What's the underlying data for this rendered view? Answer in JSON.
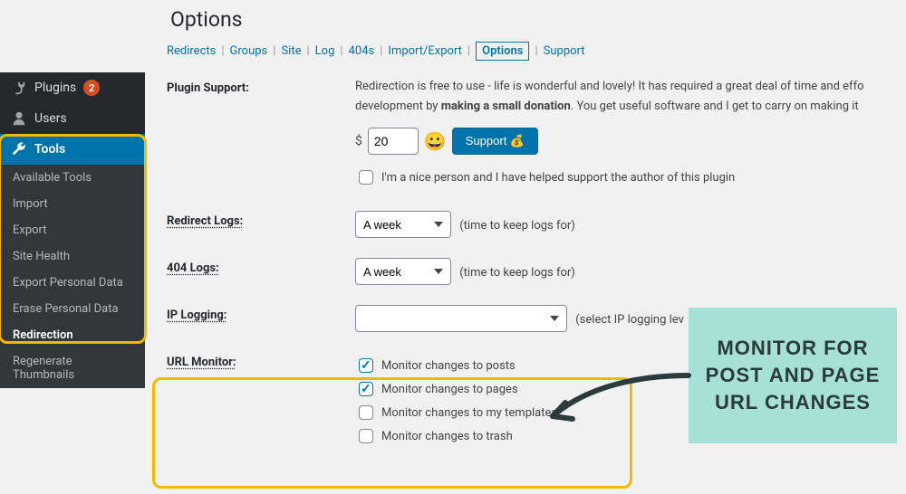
{
  "page": {
    "title": "Options"
  },
  "tabs": {
    "items": [
      "Redirects",
      "Groups",
      "Site",
      "Log",
      "404s",
      "Import/Export",
      "Options",
      "Support"
    ],
    "active": "Options"
  },
  "sidebar": {
    "plugins": {
      "label": "Plugins",
      "badge": "2"
    },
    "users": {
      "label": "Users"
    },
    "tools": {
      "label": "Tools"
    },
    "subs": [
      "Available Tools",
      "Import",
      "Export",
      "Site Health",
      "Export Personal Data",
      "Erase Personal Data",
      "Redirection",
      "Regenerate Thumbnails"
    ]
  },
  "support": {
    "label": "Plugin Support:",
    "desc1_a": "Redirection is free to use - life is wonderful and lovely! It has required a great deal of time and effo",
    "desc1_b": "development by ",
    "desc1_bold": "making a small donation",
    "desc1_c": ". You get useful software and I get to carry on making it",
    "currency": "$",
    "amount": "20",
    "button": "Support 💰",
    "nice": "I'm a nice person and I have helped support the author of this plugin"
  },
  "logs": {
    "redirect_label": "Redirect Logs:",
    "nf_label": "404 Logs:",
    "value": "A week",
    "hint": "(time to keep logs for)"
  },
  "ip": {
    "label": "IP Logging:",
    "hint": "(select IP logging lev"
  },
  "monitor": {
    "label": "URL Monitor:",
    "opts": [
      "Monitor changes to posts",
      "Monitor changes to pages",
      "Monitor changes to my templates",
      "Monitor changes to trash"
    ]
  },
  "callout": "MONITOR FOR POST AND PAGE URL CHANGES"
}
